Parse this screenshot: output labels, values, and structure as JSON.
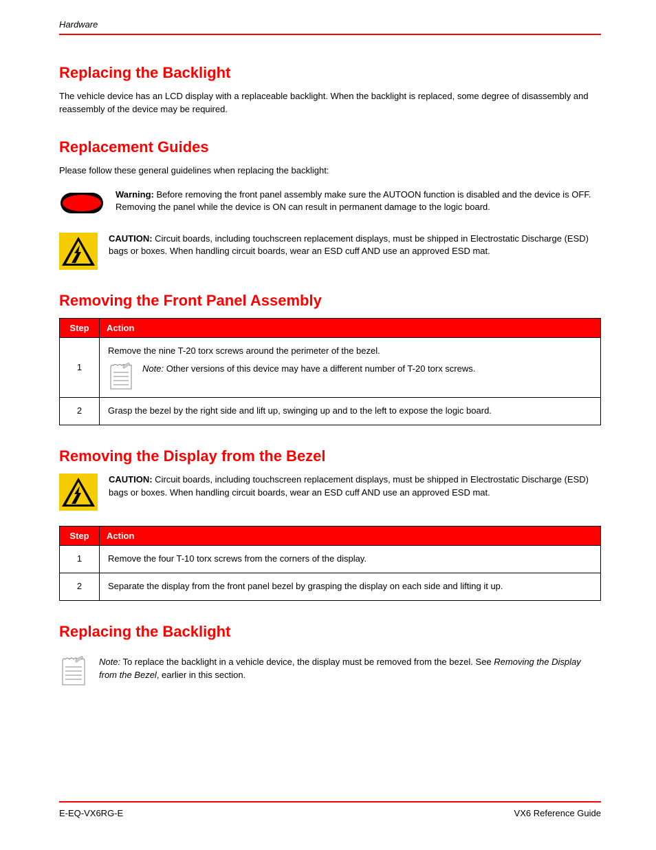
{
  "running_head": "Hardware",
  "sections": {
    "backlight": {
      "title": "Replacing the Backlight",
      "para": "The vehicle device has an LCD display with a replaceable backlight. When the backlight is replaced, some degree of disassembly and reassembly of the device may be required."
    },
    "guides": {
      "title": "Replacement Guides",
      "intro": "Please follow these general guidelines when replacing the backlight:",
      "warning": {
        "label": "Warning: ",
        "text": "Before removing the front panel assembly make sure the AUTOON function is disabled and the device is OFF. Removing the panel while the device is ON can result in permanent damage to the logic board."
      },
      "esd": {
        "label": "CAUTION: ",
        "text": "Circuit boards, including touchscreen replacement displays, must be shipped in Electrostatic Discharge (ESD) bags or boxes. When handling circuit boards, wear an ESD cuff AND use an approved ESD mat."
      }
    },
    "remove_panel": {
      "title": "Removing the Front Panel Assembly",
      "table": {
        "headers": {
          "step": "Step",
          "action": "Action"
        },
        "rows": [
          {
            "num": "1",
            "text": "Remove the nine T-20 torx screws around the perimeter of the bezel.",
            "note": {
              "label": "Note:",
              "text": "Other versions of this device may have a different number of T-20 torx screws."
            }
          },
          {
            "num": "2",
            "text": "Grasp the bezel by the right side and lift up, swinging up and to the left to expose the logic board."
          }
        ]
      }
    },
    "remove_bezel": {
      "title": "Removing the Display from the Bezel",
      "esd": {
        "label": "CAUTION: ",
        "text": "Circuit boards, including touchscreen replacement displays, must be shipped in Electrostatic Discharge (ESD) bags or boxes. When handling circuit boards, wear an ESD cuff AND use an approved ESD mat."
      },
      "table": {
        "headers": {
          "step": "Step",
          "action": "Action"
        },
        "rows": [
          {
            "num": "1",
            "text": "Remove the four T-10 torx screws from the corners of the display."
          },
          {
            "num": "2",
            "text": "Separate the display from the front panel bezel by grasping the display on each side and lifting it up."
          }
        ]
      }
    },
    "replace_backlight": {
      "title": "Replacing the Backlight",
      "note": {
        "label": "Note:",
        "text_lead": "To replace the backlight in a vehicle device, the display must be removed from the bezel. See ",
        "text_emph": "Removing the Display from the Bezel",
        "text_tail": ", earlier in this section."
      }
    }
  },
  "footer": {
    "left": "E-EQ-VX6RG-E",
    "right": "VX6 Reference Guide"
  }
}
